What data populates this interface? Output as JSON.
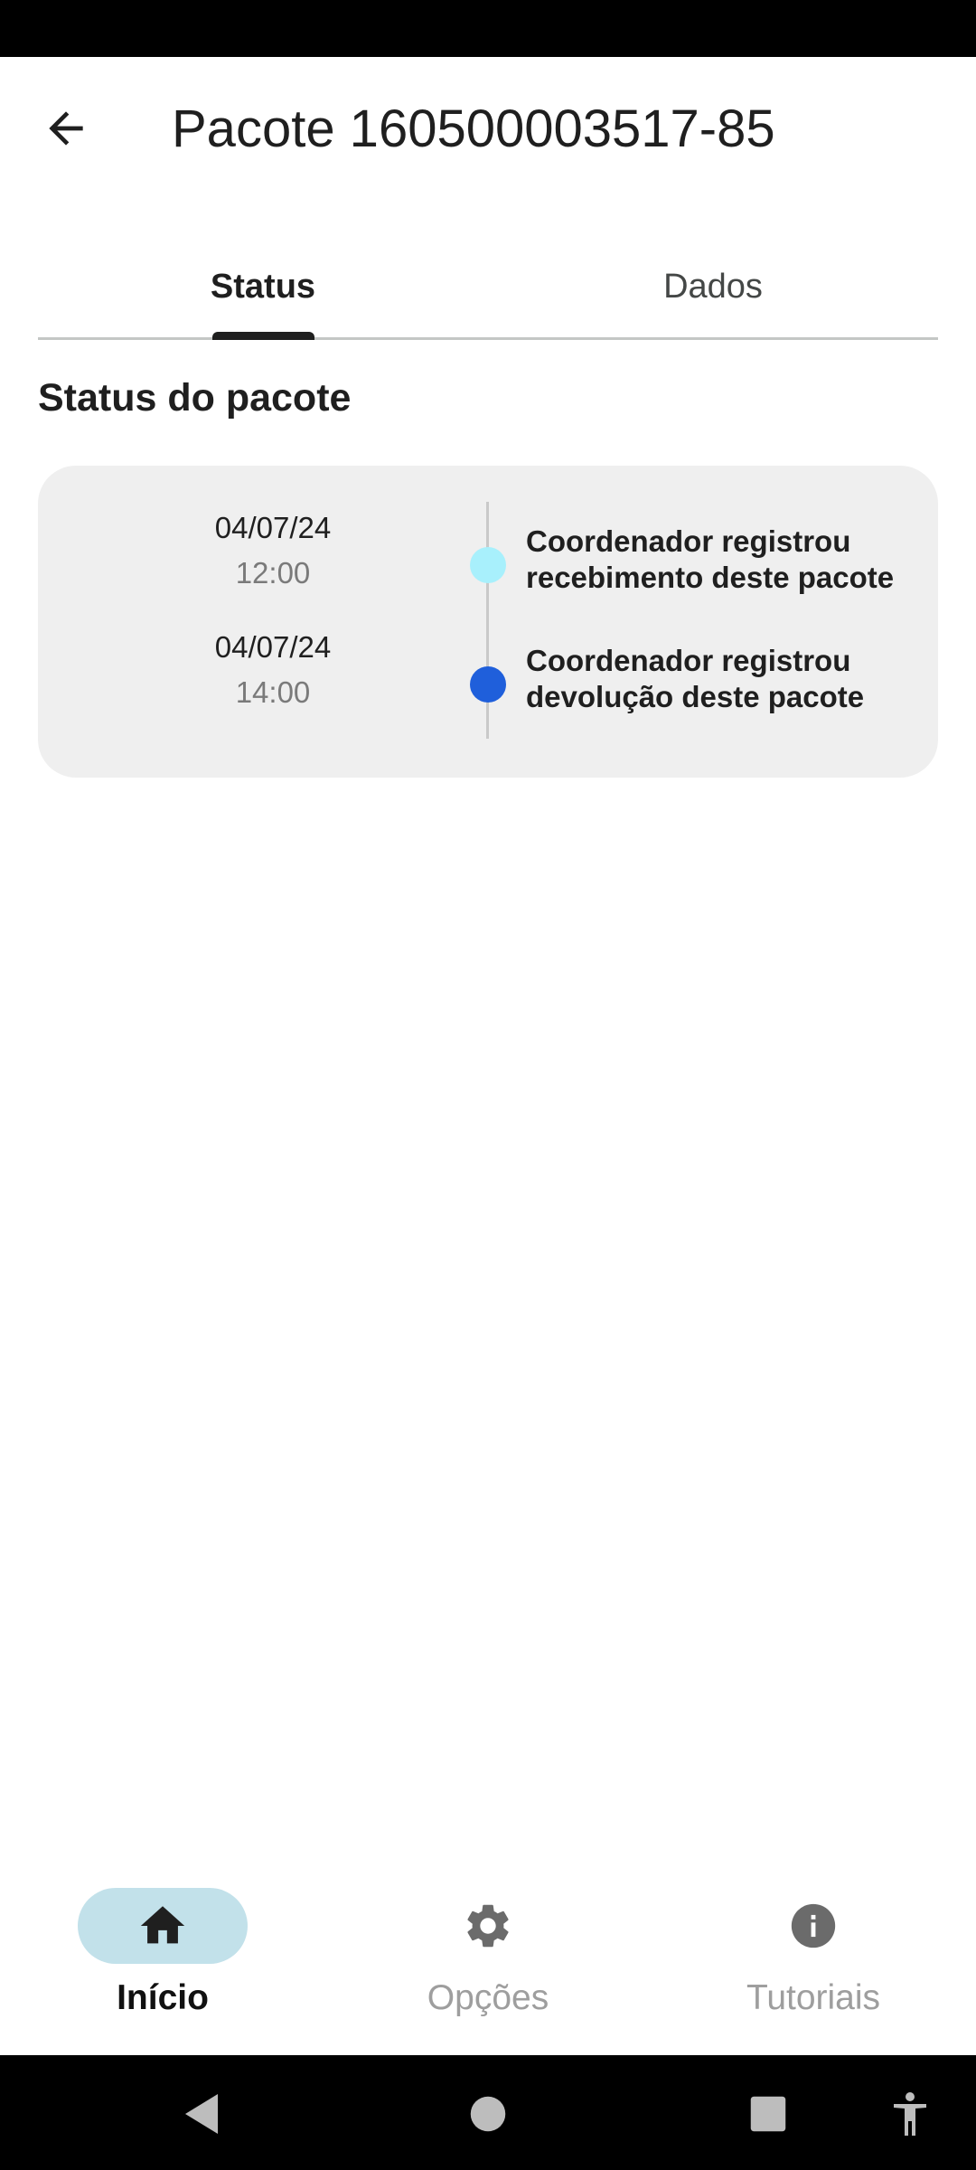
{
  "header": {
    "title": "Pacote 160500003517-85"
  },
  "tabs": [
    {
      "label": "Status",
      "selected": true
    },
    {
      "label": "Dados",
      "selected": false
    }
  ],
  "section": {
    "title": "Status do pacote"
  },
  "timeline": [
    {
      "date": "04/07/24",
      "time": "12:00",
      "description": "Coordenador registrou recebimento deste pacote",
      "dot_color": "#a8f0fc"
    },
    {
      "date": "04/07/24",
      "time": "14:00",
      "description": "Coordenador registrou devolução deste pacote",
      "dot_color": "#1f5fdb"
    }
  ],
  "bottom_nav": [
    {
      "label": "Início",
      "icon": "home-icon",
      "selected": true
    },
    {
      "label": "Opções",
      "icon": "gear-icon",
      "selected": false
    },
    {
      "label": "Tutoriais",
      "icon": "info-icon",
      "selected": false
    }
  ],
  "colors": {
    "nav_active_pill": "#c2e1ea",
    "card_background": "#efefef",
    "accent_blue": "#1f5fdb",
    "accent_cyan": "#a8f0fc"
  },
  "system_nav": [
    "back-icon",
    "home-circle-icon",
    "recents-icon",
    "accessibility-icon"
  ]
}
